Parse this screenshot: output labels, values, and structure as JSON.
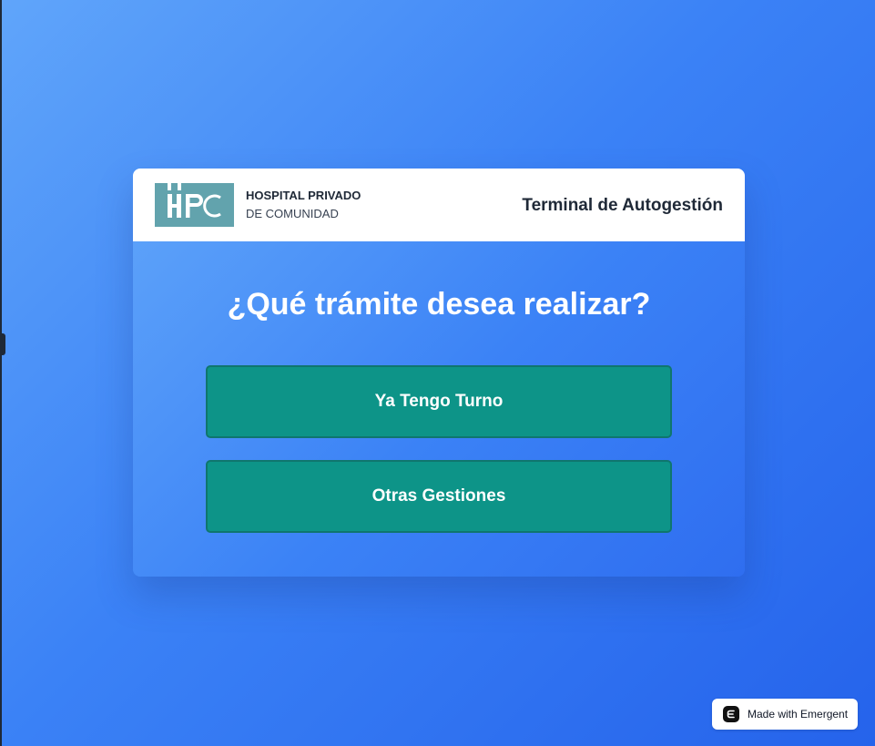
{
  "brand": {
    "logo_text": "HPC",
    "name_line1": "HOSPITAL PRIVADO",
    "name_line2": "DE COMUNIDAD"
  },
  "header": {
    "title": "Terminal de Autogestión"
  },
  "main": {
    "question": "¿Qué trámite desea realizar?",
    "options": [
      {
        "label": "Ya Tengo Turno"
      },
      {
        "label": "Otras Gestiones"
      }
    ]
  },
  "badge": {
    "label": "Made with Emergent",
    "icon": "emergent-logo-icon"
  },
  "colors": {
    "background_start": "#60a5fa",
    "background_end": "#2563eb",
    "logo_bg": "#62a3ad",
    "button_bg": "#0d9488",
    "button_border": "#0f766e"
  }
}
